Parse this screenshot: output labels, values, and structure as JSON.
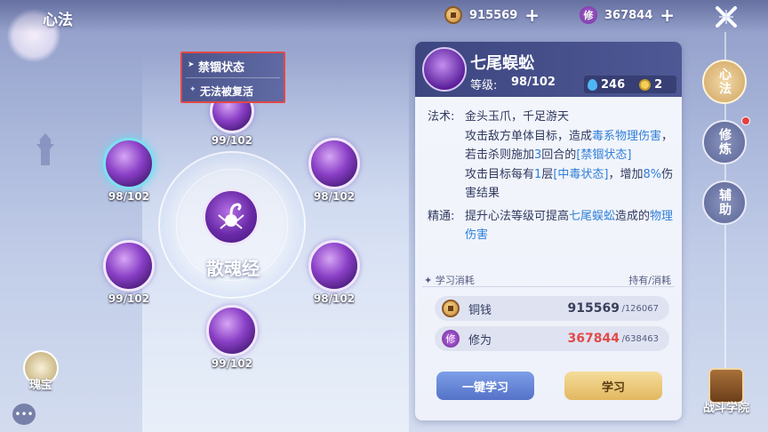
{
  "header": {
    "title": "心法",
    "currency1": {
      "value": "915569",
      "icon": "coin-icon"
    },
    "currency2": {
      "icon_text": "修",
      "value": "367844",
      "icon": "xiu-icon"
    }
  },
  "status_popup": {
    "title": "禁锢状态",
    "description": "无法被复活"
  },
  "skill_tree": {
    "center_label": "散魂经",
    "nodes": [
      {
        "level": "99/102"
      },
      {
        "level": "98/102"
      },
      {
        "level": "98/102"
      },
      {
        "level": "99/102"
      },
      {
        "level": "98/102"
      },
      {
        "level": "99/102"
      }
    ]
  },
  "detail": {
    "name": "七尾蜈蚣",
    "level_label": "等级:",
    "level_value": "98/102",
    "stat_drop": "246",
    "stat_time": "2",
    "desc_label_1": "法术:",
    "desc_line_1": "金头玉爪，千足游天",
    "desc_line_2a": "攻击敌方单体目标，造成",
    "desc_line_2b": "毒系物理伤害",
    "desc_line_2c": "，若击杀则施加",
    "desc_line_2d": "3",
    "desc_line_2e": "回合的",
    "desc_line_2f": "[禁锢状态]",
    "desc_line_3a": "攻击目标每有",
    "desc_line_3b": "1",
    "desc_line_3c": "层",
    "desc_line_3d": "[中毒状态]",
    "desc_line_3e": "，增加",
    "desc_line_3f": "8%",
    "desc_line_3g": "伤害结果",
    "desc_label_2": "精通:",
    "desc_line_4a": "提升心法等级可提高",
    "desc_line_4b": "七尾蜈蚣",
    "desc_line_4c": "造成的",
    "desc_line_4d": "物理伤害",
    "cost_title": "学习消耗",
    "cost_right": "持有/消耗",
    "costs": [
      {
        "name": "铜钱",
        "have": "915569",
        "need": "/126067",
        "have_color": "#3a3f5c"
      },
      {
        "name": "修为",
        "icon_text": "修",
        "have": "367844",
        "need": "/638463",
        "have_color": "#e34a4a"
      }
    ],
    "btn_learn_one": "一键学习",
    "btn_learn": "学习"
  },
  "side_tabs": [
    {
      "label": "心法"
    },
    {
      "label": "修炼"
    },
    {
      "label": "辅助"
    }
  ],
  "bottom": {
    "treasure_label": "瑰宝",
    "academy_label": "战斗学院"
  },
  "colors": {
    "accent": "#2f7fd8",
    "warning": "#e34a4a",
    "highlight_border": "#e14848"
  }
}
